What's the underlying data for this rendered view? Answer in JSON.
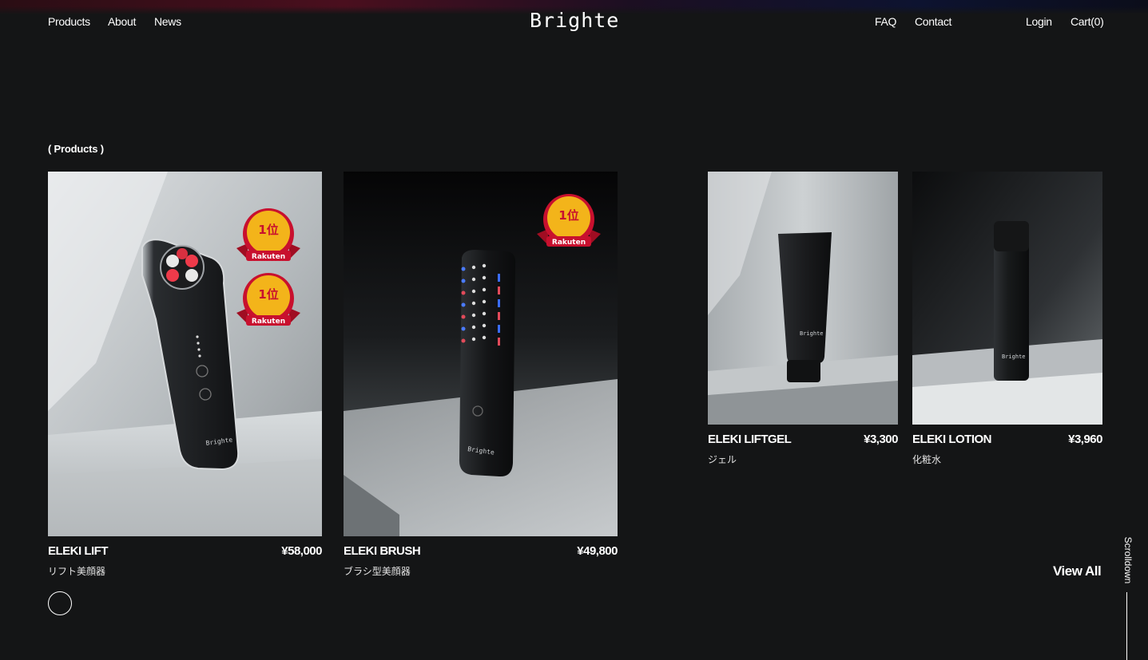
{
  "nav": {
    "left": [
      "Products",
      "About",
      "News"
    ],
    "logo": "Brighte",
    "right": [
      "FAQ",
      "Contact"
    ],
    "login": "Login",
    "cart": "Cart(0)"
  },
  "section_label": "( Products )",
  "products": [
    {
      "name": "ELEKI LIFT",
      "price": "¥58,000",
      "subtitle": "リフト美顔器",
      "badges": 2
    },
    {
      "name": "ELEKI BRUSH",
      "price": "¥49,800",
      "subtitle": "ブラシ型美顔器",
      "badges": 1
    },
    {
      "name": "ELEKI LIFTGEL",
      "price": "¥3,300",
      "subtitle": "ジェル",
      "badges": 0
    },
    {
      "name": "ELEKI LOTION",
      "price": "¥3,960",
      "subtitle": "化粧水",
      "badges": 0
    }
  ],
  "badge": {
    "rank": "1位",
    "brand": "Rakuten"
  },
  "product_logo": "Brighte",
  "view_all": "View All",
  "scroll_label": "Scrolldown",
  "colors": {
    "background": "#141516",
    "badge_gold": "#f3b41a",
    "badge_red": "#c8102e"
  }
}
